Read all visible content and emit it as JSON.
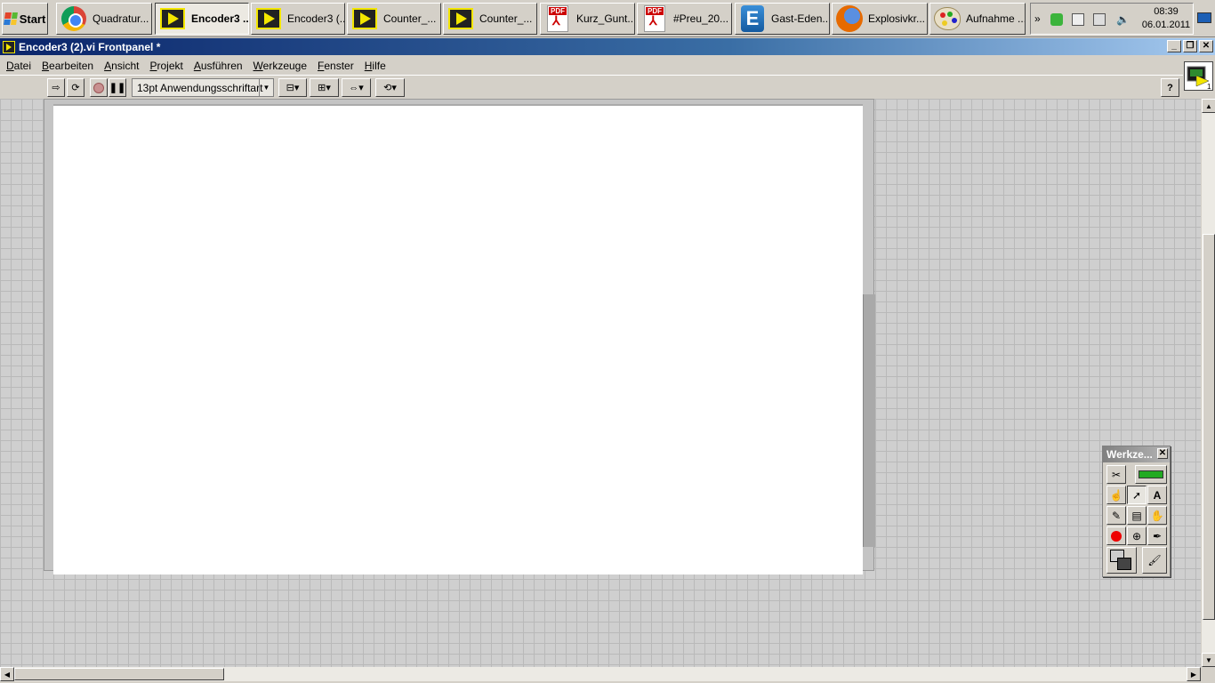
{
  "taskbar": {
    "start_label": "Start",
    "tasks": [
      {
        "label": "Quadratur...",
        "icon": "chrome-icon"
      },
      {
        "label": "Encoder3 ...",
        "icon": "labview-vi-icon"
      },
      {
        "label": "Encoder3 (...",
        "icon": "labview-vi-icon"
      },
      {
        "label": "Counter_...",
        "icon": "labview-vi-icon"
      },
      {
        "label": "Counter_...",
        "icon": "labview-vi-icon"
      },
      {
        "label": "Kurz_Gunt...",
        "icon": "pdf-icon"
      },
      {
        "label": "#Preu_20...",
        "icon": "pdf-icon"
      },
      {
        "label": "Gast-Eden...",
        "icon": "e-app-icon"
      },
      {
        "label": "Explosivkr...",
        "icon": "firefox-icon"
      },
      {
        "label": "Aufnahme ...",
        "icon": "paint-icon"
      }
    ],
    "active_task_index": 1,
    "pdf_badge": "PDF",
    "pdf_sub": "Adobe",
    "e_letter": "E",
    "clock_time": "08:39",
    "clock_date": "06.01.2011"
  },
  "window": {
    "title": "Encoder3 (2).vi Frontpanel *",
    "minimize": "_",
    "restore": "❐",
    "close": "✕"
  },
  "menu": {
    "items": [
      {
        "hotkey": "D",
        "rest": "atei"
      },
      {
        "hotkey": "B",
        "rest": "earbeiten"
      },
      {
        "hotkey": "A",
        "rest": "nsicht"
      },
      {
        "hotkey": "P",
        "rest": "rojekt"
      },
      {
        "hotkey": "A",
        "rest": "usführen"
      },
      {
        "hotkey": "W",
        "rest": "erkzeuge"
      },
      {
        "hotkey": "F",
        "rest": "enster"
      },
      {
        "hotkey": "H",
        "rest": "ilfe"
      }
    ]
  },
  "toolbar": {
    "font_selector": "13pt Anwendungsschriftart",
    "help_label": "?",
    "vi_icon_badge": "1"
  },
  "tools_palette": {
    "title": "Werkze...",
    "close": "✕",
    "text_tool": "A"
  },
  "colors": {
    "titlebar_start": "#0a246a",
    "titlebar_end": "#a6caf0",
    "labview_yellow": "#f3e600",
    "panel_grid": "#b9b9b9",
    "panel_bg": "#cfcfcf"
  }
}
